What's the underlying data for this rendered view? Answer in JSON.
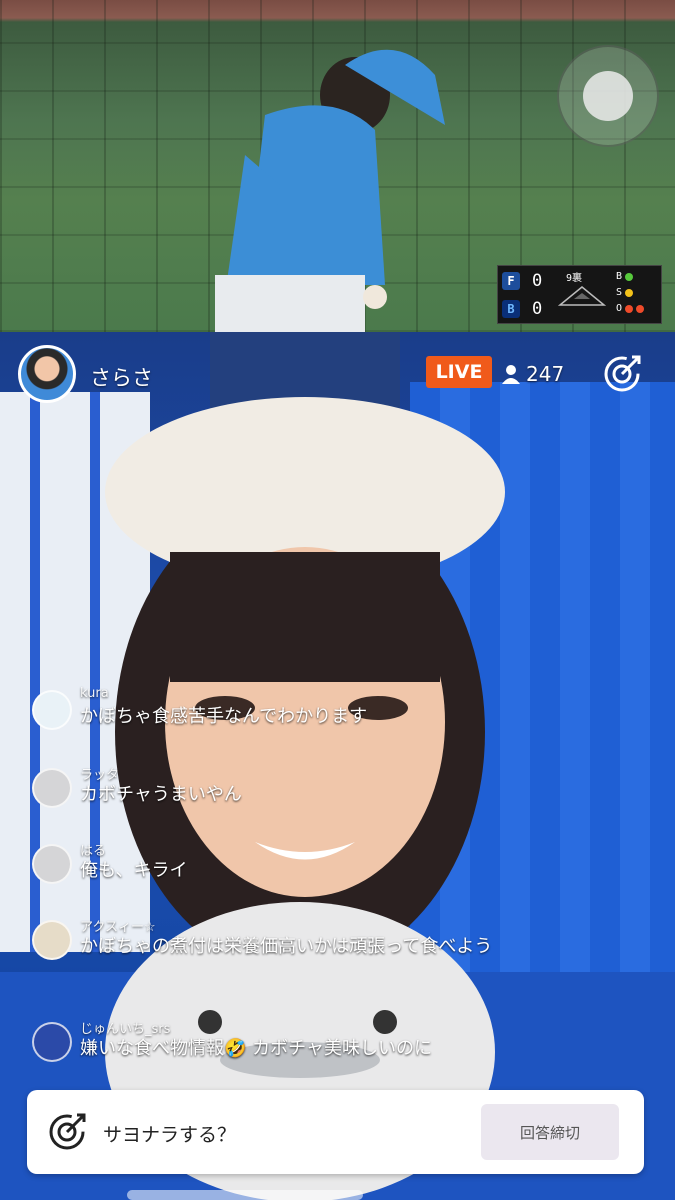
{
  "scoreboard": {
    "team_home_logo": "F",
    "team_away_logo": "B",
    "score_home": "0",
    "score_away": "0",
    "inning": "9裏",
    "count_labels": [
      "B",
      "S",
      "O"
    ],
    "colors": {
      "ball": "#57c93c",
      "strike": "#f3c21a",
      "out": "#ef4b2a"
    }
  },
  "stream": {
    "streamer_name": "さらさ",
    "live_label": "LIVE",
    "viewer_count": "247",
    "accent": "#f05a1a"
  },
  "comments": [
    {
      "user": "kura",
      "text": "かぼちゃ食感苦手なんでわかります"
    },
    {
      "user": "ラッタ",
      "text": "カボチャうまいやん"
    },
    {
      "user": "はる",
      "text": "俺も、キライ"
    },
    {
      "user": "アクスィー☆",
      "text": "かぼちゃの煮付は栄養価高いかは頑張って食べよう"
    },
    {
      "user": "じゅんいち_srs",
      "text": "嫌いな食べ物情報🤣 カボチャ美味しいのに"
    }
  ],
  "poll": {
    "question": "サヨナラする？",
    "close_button": "回答締切"
  }
}
